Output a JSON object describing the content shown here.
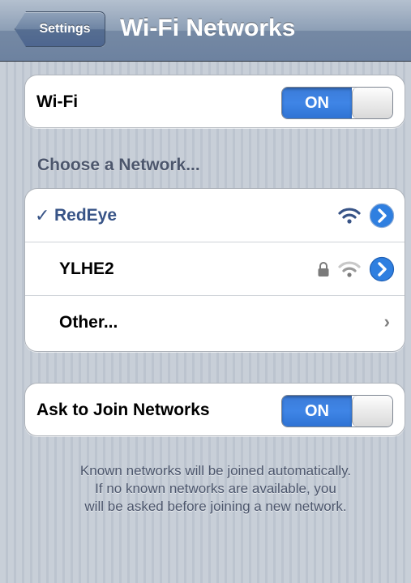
{
  "navbar": {
    "back_label": "Settings",
    "title": "Wi-Fi Networks"
  },
  "wifi": {
    "label": "Wi-Fi",
    "switch_state": "ON"
  },
  "networks_section": {
    "header": "Choose a Network...",
    "items": [
      {
        "name": "RedEye",
        "selected": true,
        "checkmark": "✓",
        "locked": false,
        "icons": [
          "wifi-icon",
          "detail-disclosure-icon"
        ]
      },
      {
        "name": "YLHE2",
        "selected": false,
        "locked": true,
        "icons": [
          "lock-icon",
          "wifi-icon",
          "detail-disclosure-icon"
        ]
      },
      {
        "name": "Other...",
        "selected": false,
        "icons": [
          "chevron-right-icon"
        ],
        "chevron": "›"
      }
    ]
  },
  "ask_to_join": {
    "label": "Ask to Join Networks",
    "switch_state": "ON"
  },
  "footer": {
    "lines": [
      "Known networks will be joined automatically.",
      "If no known networks are available, you",
      "will be asked before joining a new network."
    ]
  },
  "colors": {
    "accent_blue": "#3f85e6",
    "selected_text": "#385487",
    "section_text": "#4c566c"
  }
}
